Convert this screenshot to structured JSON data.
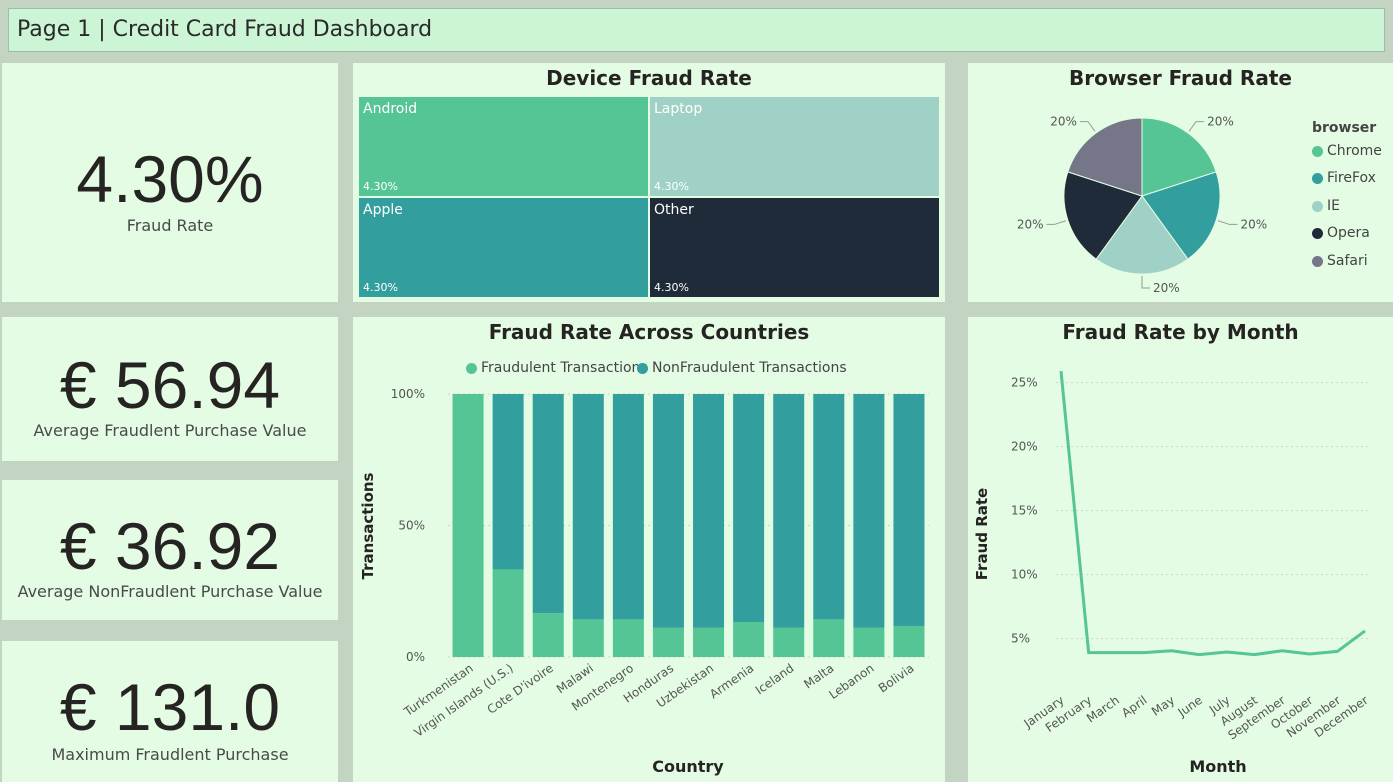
{
  "header": {
    "title": "Page 1 | Credit Card Fraud Dashboard"
  },
  "cards": [
    {
      "value": "4.30%",
      "label": "Fraud Rate"
    },
    {
      "value": "€ 56.94",
      "label": "Average Fraudlent Purchase Value"
    },
    {
      "value": "€ 36.92",
      "label": "Average NonFraudlent Purchase Value"
    },
    {
      "value": "€ 131.0",
      "label": "Maximum Fraudlent Purchase"
    }
  ],
  "colors": {
    "green": "#55c595",
    "teal": "#329e9e",
    "lightteal": "#9fd1c6",
    "navy": "#1f2b38",
    "gray": "#757789"
  },
  "chart_data": [
    {
      "type": "treemap",
      "title": "Device Fraud Rate",
      "items": [
        {
          "name": "Android",
          "value": "4.30%",
          "color": "#55c595"
        },
        {
          "name": "Laptop",
          "value": "4.30%",
          "color": "#9fd1c6"
        },
        {
          "name": "Apple",
          "value": "4.30%",
          "color": "#329e9e"
        },
        {
          "name": "Other",
          "value": "4.30%",
          "color": "#1f2b38"
        }
      ]
    },
    {
      "type": "pie",
      "title": "Browser Fraud Rate",
      "legend_title": "browser",
      "legend_position": "right",
      "slices": [
        {
          "name": "Chrome",
          "value": 20,
          "label": "20%",
          "color": "#55c595"
        },
        {
          "name": "FireFox",
          "value": 20,
          "label": "20%",
          "color": "#329e9e"
        },
        {
          "name": "IE",
          "value": 20,
          "label": "20%",
          "color": "#9fd1c6"
        },
        {
          "name": "Opera",
          "value": 20,
          "label": "20%",
          "color": "#1f2b38"
        },
        {
          "name": "Safari",
          "value": 20,
          "label": "20%",
          "color": "#757789"
        }
      ]
    },
    {
      "type": "bar",
      "stacked": "100%",
      "title": "Fraud Rate Across Countries",
      "xlabel": "Country",
      "ylabel": "Transactions",
      "legend_position": "top",
      "ylim": [
        0,
        100
      ],
      "yticks": [
        "0%",
        "50%",
        "100%"
      ],
      "categories": [
        "Turkmenistan",
        "Virgin Islands (U.S.)",
        "Cote D'ivoire",
        "Malawi",
        "Montenegro",
        "Honduras",
        "Uzbekistan",
        "Armenia",
        "Iceland",
        "Malta",
        "Lebanon",
        "Bolivia"
      ],
      "series": [
        {
          "name": "Fraudulent Transactions",
          "color": "#55c595",
          "values": [
            100,
            33.3,
            16.7,
            14.3,
            14.3,
            11.1,
            11.1,
            13.3,
            11.1,
            14.3,
            11.1,
            11.8
          ]
        },
        {
          "name": "NonFraudulent Transactions",
          "color": "#329e9e",
          "values": [
            0,
            66.7,
            83.3,
            85.7,
            85.7,
            88.9,
            88.9,
            86.7,
            88.9,
            85.7,
            88.9,
            88.2
          ]
        }
      ]
    },
    {
      "type": "line",
      "title": "Fraud Rate by Month",
      "xlabel": "Month",
      "ylabel": "Fraud Rate",
      "yticks": [
        "5%",
        "10%",
        "15%",
        "20%",
        "25%"
      ],
      "ylim": [
        2,
        27
      ],
      "grid": true,
      "categories": [
        "January",
        "February",
        "March",
        "April",
        "May",
        "June",
        "July",
        "August",
        "September",
        "October",
        "November",
        "December"
      ],
      "values": [
        25.9,
        3.9,
        3.9,
        3.9,
        4.05,
        3.75,
        3.95,
        3.75,
        4.05,
        3.8,
        4.0,
        5.6
      ],
      "color": "#55c595"
    }
  ]
}
